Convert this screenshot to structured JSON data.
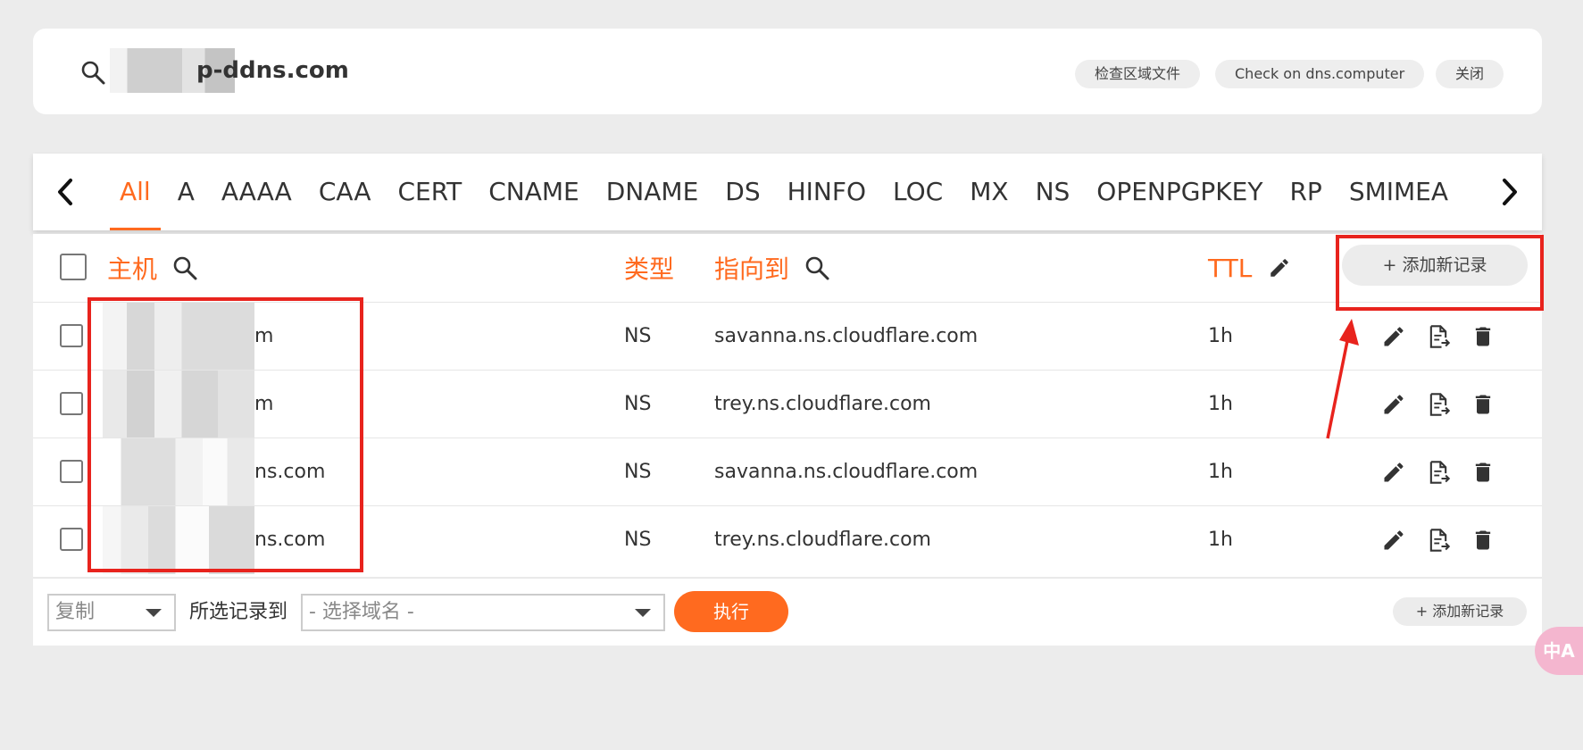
{
  "header": {
    "domain_suffix": "p-ddns.com",
    "buttons": {
      "check_zone_file": "检查区域文件",
      "check_dns_computer": "Check on dns.computer",
      "close": "关闭"
    }
  },
  "tabs": {
    "items": [
      "All",
      "A",
      "AAAA",
      "CAA",
      "CERT",
      "CNAME",
      "DNAME",
      "DS",
      "HINFO",
      "LOC",
      "MX",
      "NS",
      "OPENPGPKEY",
      "RP",
      "SMIMEA"
    ],
    "active": "All"
  },
  "table": {
    "headers": {
      "host": "主机",
      "type": "类型",
      "target": "指向到",
      "ttl": "TTL"
    },
    "add_record_label": "+ 添加新记录",
    "rows": [
      {
        "host_visible": "m",
        "type": "NS",
        "target": "savanna.ns.cloudflare.com",
        "ttl": "1h"
      },
      {
        "host_visible": "m",
        "type": "NS",
        "target": "trey.ns.cloudflare.com",
        "ttl": "1h"
      },
      {
        "host_visible": "ns.com",
        "type": "NS",
        "target": "savanna.ns.cloudflare.com",
        "ttl": "1h"
      },
      {
        "host_visible": "ns.com",
        "type": "NS",
        "target": "trey.ns.cloudflare.com",
        "ttl": "1h"
      }
    ]
  },
  "footer": {
    "action_select": "复制",
    "label": "所选记录到",
    "domain_select_placeholder": "- 选择域名 -",
    "execute_label": "执行",
    "add_record_label": "+ 添加新记录"
  },
  "translate_badge": "中A",
  "colors": {
    "accent": "#ff6a1f",
    "annotation_red": "#e8231d",
    "background": "#ececec"
  }
}
